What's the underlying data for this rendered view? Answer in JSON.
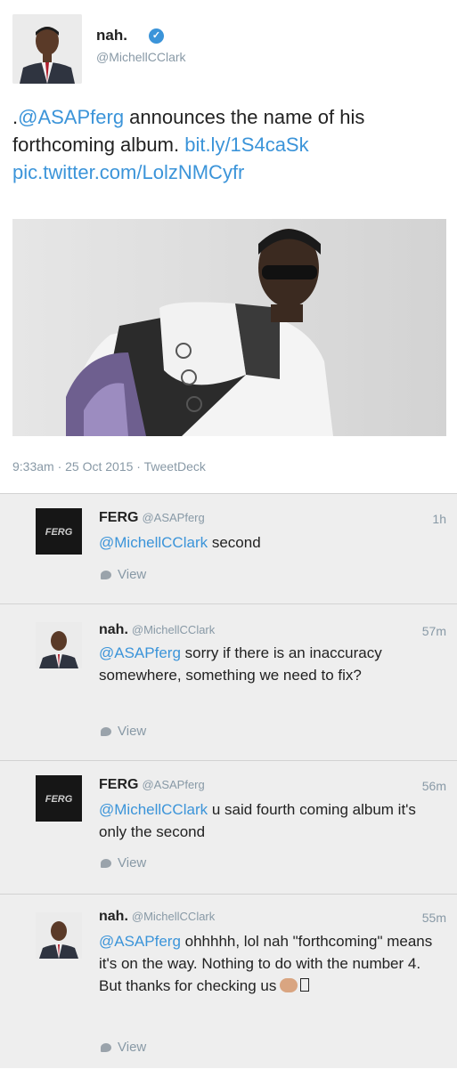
{
  "tweet": {
    "name": "nah.",
    "handle": "@MichellCClark",
    "text_prefix": ".",
    "mention": "@ASAPferg",
    "text_body": " announces the name of his forthcoming album. ",
    "link": "bit.ly/1S4caSk",
    "pic_link": "pic.twitter.com/LolzNMCyfr",
    "meta": "9:33am · 25 Oct 2015 · TweetDeck"
  },
  "replies": [
    {
      "name": "FERG",
      "handle": "@ASAPferg",
      "time": "1h",
      "mention": "@MichellCClark",
      "text": " second",
      "view": "View",
      "avatar_text": "FERG"
    },
    {
      "name": "nah.",
      "handle": "@MichellCClark",
      "time": "57m",
      "mention": "@ASAPferg",
      "text": " sorry if there is an inaccuracy somewhere, something we need to fix?",
      "view": "View"
    },
    {
      "name": "FERG",
      "handle": "@ASAPferg",
      "time": "56m",
      "mention": "@MichellCClark",
      "text": " u said fourth coming album it's only the second",
      "view": "View",
      "avatar_text": "FERG"
    },
    {
      "name": "nah.",
      "handle": "@MichellCClark",
      "time": "55m",
      "mention": "@ASAPferg",
      "text": " ohhhhh, lol nah \"forthcoming\" means it's on the way. Nothing to do with the number 4. But thanks for checking us",
      "view": "View"
    }
  ],
  "colors": {
    "link": "#3b94d9",
    "muted": "#8899a6",
    "reply_bg": "#eeeeee"
  }
}
